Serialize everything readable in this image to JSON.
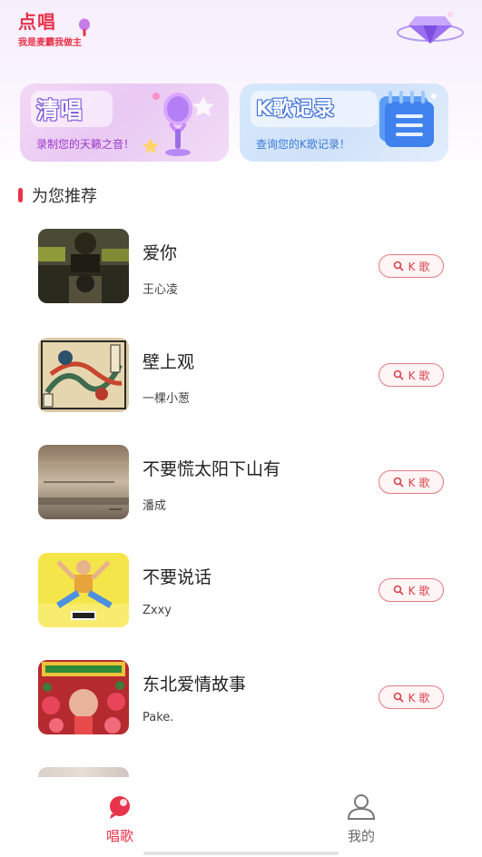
{
  "header": {
    "logo_title": "点唱",
    "logo_subtitle": "我是麦霸我做主"
  },
  "cards": [
    {
      "title": "清唱",
      "subtitle": "录制您的天籁之音！"
    },
    {
      "title": "K歌记录",
      "subtitle": "查询您的K歌记录！"
    }
  ],
  "section": {
    "title": "为您推荐"
  },
  "songs": [
    {
      "title": "爱你",
      "artist": "王心凌",
      "button": "K 歌"
    },
    {
      "title": "壁上观",
      "artist": "一棵小葱",
      "button": "K 歌"
    },
    {
      "title": "不要慌太阳下山有",
      "artist": "潘成",
      "button": "K 歌"
    },
    {
      "title": "不要说话",
      "artist": "Zxxy",
      "button": "K 歌"
    },
    {
      "title": "东北爱情故事",
      "artist": "Pake.",
      "button": "K 歌"
    }
  ],
  "nav": {
    "sing": "唱歌",
    "mine": "我的"
  },
  "colors": {
    "accent": "#e8334a",
    "button_border": "#e57b84"
  },
  "icons": {
    "search": "search-icon",
    "sing": "microphone-bubble-icon",
    "mine": "user-icon",
    "gem": "gem-icon"
  }
}
